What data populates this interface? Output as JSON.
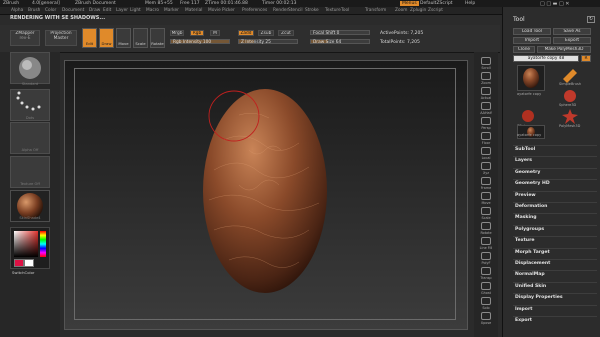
{
  "app": {
    "title": "ZBrush",
    "version": "4.0[general]",
    "document": "ZBrush Document",
    "mem": "Mem 85+55",
    "free": "Free 117",
    "ztime": "ZTime 00:01:46.88",
    "timer": "Timer 00:02:13",
    "menus_btn": "Menus",
    "zscript_btn": "DefaultZScript",
    "help_btn": "Help"
  },
  "menus": [
    "Alpha",
    "Brush",
    "Color",
    "Document",
    "Draw",
    "Edit",
    "Layer",
    "Light",
    "Macro",
    "Marker",
    "Material",
    "Movie",
    "Picker",
    "Preferences",
    "Render",
    "Stencil",
    "Stroke",
    "Texture",
    "Tool",
    "Transform",
    "Zoom",
    "Zplugin",
    "Zscript"
  ],
  "notice": "RENDERING WITH SE SHADOWS...",
  "toolbar": {
    "zmapper": "ZMapper",
    "zmapper_sub": "rev-E",
    "projection_master": "Projection",
    "projection_master_sub": "Master",
    "tool_edit": "Edit",
    "tool_draw": "Draw",
    "tool_move": "Move",
    "tool_scale": "Scale",
    "tool_rotate": "Rotate",
    "mrgb": "Mrgb",
    "rgb": "Rgb",
    "m": "M",
    "rgb_intensity": "Rgb Intensity 100",
    "zadd": "Zadd",
    "zsub": "Zsub",
    "zcut": "Zcut",
    "z_intensity": "Z Intensity 25",
    "focal_shift": "Focal Shift 0",
    "draw_size": "Draw Size 64",
    "active_points": "ActivePoints: 7,205",
    "total_points": "TotalPoints: 7,205"
  },
  "left_shelf": {
    "brush_label": "Standard",
    "stroke_label": "Dots",
    "alpha_label": "Alpha Off",
    "texture_label": "Texture Off",
    "material_label": "SkinShade4",
    "switch_color": "SwitchColor"
  },
  "right_shelf": [
    "Scroll",
    "Zoom",
    "Actual",
    "AAHalf",
    "Persp",
    "Floor",
    "Local",
    "Xyz",
    "Frame",
    "Move",
    "Scale",
    "Rotate",
    "Line Fill",
    "PolyF",
    "Transp",
    "Ghost",
    "Solo",
    "Xpose"
  ],
  "tray": {
    "title": "Tool",
    "load_tool": "Load Tool",
    "save_as": "Save As",
    "import": "Import",
    "export": "Export",
    "clone": "Clone",
    "make_polymesh": "Make PolyMesh3D",
    "current_tool": "ayatorfe copy 48",
    "tool_count": "R",
    "tools": [
      {
        "label": "ayatorfe copy"
      },
      {
        "label": "SimpleBrush"
      },
      {
        "label": "Sphere3D"
      },
      {
        "label": "ZSphere"
      },
      {
        "label": "PolyMesh3D"
      },
      {
        "label": "ayatorfe copy"
      }
    ],
    "palette": [
      "SubTool",
      "Layers",
      "Geometry",
      "Geometry HD",
      "Preview",
      "Deformation",
      "Masking",
      "Polygroups",
      "Texture",
      "Morph Target",
      "Displacement",
      "NormalMap",
      "Unified Skin",
      "Display Properties",
      "Import",
      "Export"
    ]
  }
}
